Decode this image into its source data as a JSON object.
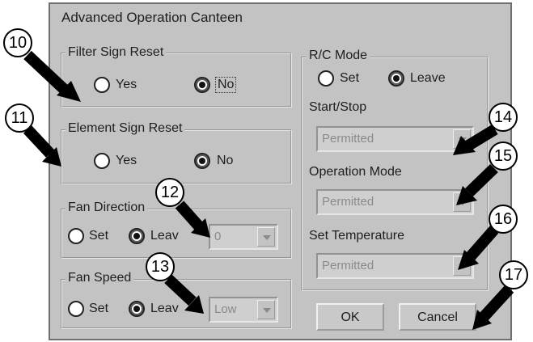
{
  "dialog": {
    "title": "Advanced Operation Canteen"
  },
  "filter_sign_reset": {
    "legend": "Filter Sign Reset",
    "yes": "Yes",
    "no": "No",
    "selected": "No"
  },
  "element_sign_reset": {
    "legend": "Element Sign Reset",
    "yes": "Yes",
    "no": "No",
    "selected": "No"
  },
  "fan_direction": {
    "legend": "Fan Direction",
    "set": "Set",
    "leave": "Leav",
    "selected": "Leave",
    "value": "0"
  },
  "fan_speed": {
    "legend": "Fan Speed",
    "set": "Set",
    "leave": "Leav",
    "selected": "Leave",
    "value": "Low"
  },
  "rc_mode": {
    "legend": "R/C Mode",
    "set": "Set",
    "leave": "Leave",
    "selected": "Leave",
    "start_stop": {
      "label": "Start/Stop",
      "value": "Permitted"
    },
    "operation_mode": {
      "label": "Operation Mode",
      "value": "Permitted"
    },
    "set_temperature": {
      "label": "Set Temperature",
      "value": "Permitted"
    }
  },
  "buttons": {
    "ok": "OK",
    "cancel": "Cancel"
  },
  "callouts": [
    "10",
    "11",
    "12",
    "13",
    "14",
    "15",
    "16",
    "17"
  ]
}
